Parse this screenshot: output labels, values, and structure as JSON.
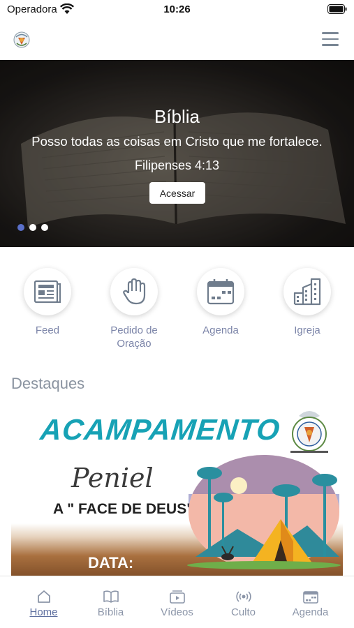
{
  "status_bar": {
    "carrier": "Operadora",
    "time": "10:26"
  },
  "header": {
    "logo_icon": "church-logo-icon",
    "menu_icon": "hamburger-menu-icon"
  },
  "hero": {
    "title": "Bíblia",
    "verse": "Posso todas as coisas em Cristo que me fortalece.",
    "reference": "Filipenses 4:13",
    "button_label": "Acessar",
    "slides": 3,
    "active_slide": 1
  },
  "quick_links": [
    {
      "label": "Feed",
      "icon": "newspaper-icon"
    },
    {
      "label": "Pedido de Oração",
      "icon": "hand-icon"
    },
    {
      "label": "Agenda",
      "icon": "calendar-icon"
    },
    {
      "label": "Igreja",
      "icon": "building-icon"
    }
  ],
  "highlights": {
    "title": "Destaques",
    "banner": {
      "headline": "ACAMPAMENTO",
      "subtitle": "Peniel",
      "tagline": "A \" FACE DE DEUS\"",
      "date_label": "DATA:"
    }
  },
  "tab_bar": [
    {
      "label": "Home",
      "icon": "home-icon",
      "active": true
    },
    {
      "label": "Bíblia",
      "icon": "book-icon",
      "active": false
    },
    {
      "label": "Vídeos",
      "icon": "video-icon",
      "active": false
    },
    {
      "label": "Culto",
      "icon": "broadcast-icon",
      "active": false
    },
    {
      "label": "Agenda",
      "icon": "calendar-icon",
      "active": false
    }
  ],
  "colors": {
    "accent": "#5a6fc9",
    "label": "#7b84a8",
    "banner_title": "#17a2b5"
  }
}
